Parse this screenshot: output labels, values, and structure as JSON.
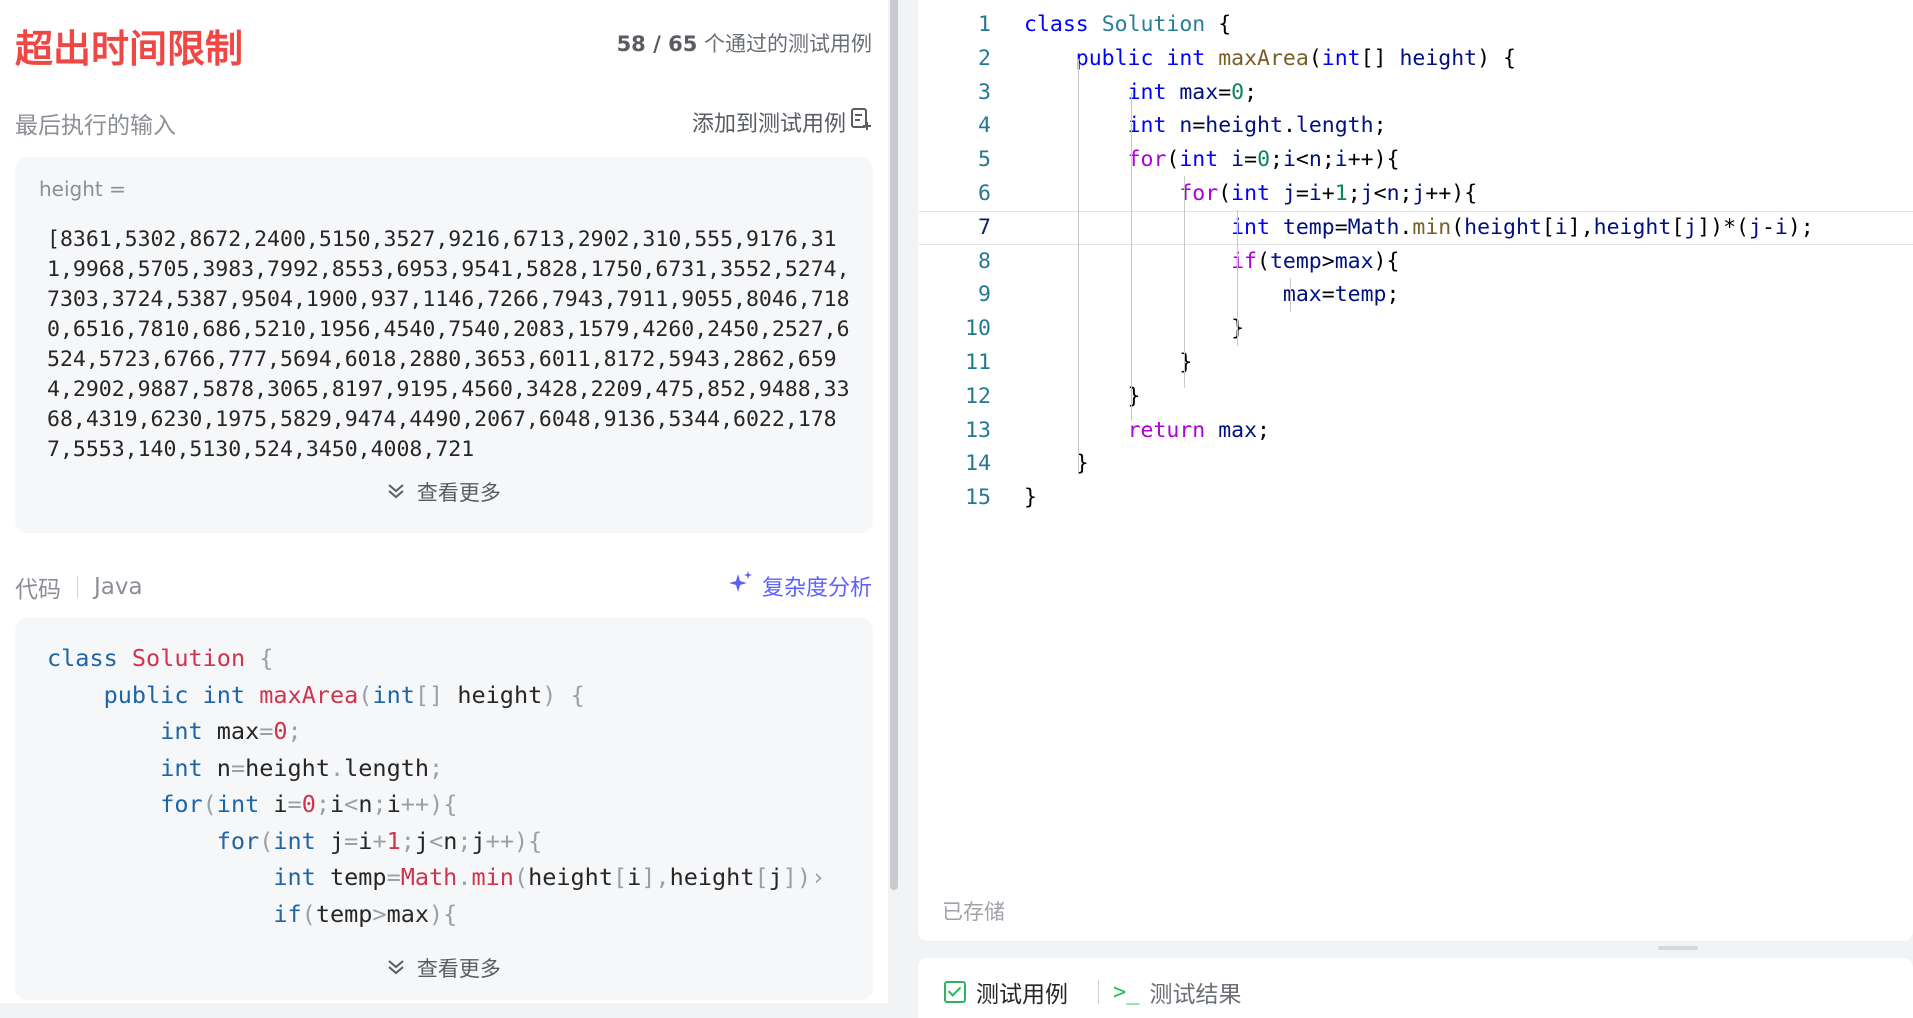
{
  "result": {
    "status_title": "超出时间限制",
    "passed": "58 / 65",
    "passed_suffix": "个通过的测试用例"
  },
  "last_input": {
    "label": "最后执行的输入",
    "add_case_label": "添加到测试用例",
    "variable_label": "height =",
    "value": "[8361,5302,8672,2400,5150,3527,9216,6713,2902,310,555,9176,311,9968,5705,3983,7992,8553,6953,9541,5828,1750,6731,3552,5274,7303,3724,5387,9504,1900,937,1146,7266,7943,7911,9055,8046,7180,6516,7810,686,5210,1956,4540,7540,2083,1579,4260,2450,2527,6524,5723,6766,777,5694,6018,2880,3653,6011,8172,5943,2862,6594,2902,9887,5878,3065,8197,9195,4560,3428,2209,475,852,9488,3368,4319,6230,1975,5829,9474,4490,2067,6048,9136,5344,6022,1787,5553,140,5130,524,3450,4008,721",
    "view_more": "查看更多"
  },
  "code_section": {
    "label": "代码",
    "language": "Java",
    "complexity_label": "复杂度分析",
    "view_more": "查看更多"
  },
  "editor": {
    "lines": [
      "class Solution {",
      "    public int maxArea(int[] height) {",
      "        int max=0;",
      "        int n=height.length;",
      "        for(int i=0;i<n;i++){",
      "            for(int j=i+1;j<n;j++){",
      "                int temp=Math.min(height[i],height[j])*(j-i);",
      "                if(temp>max){",
      "                    max=temp;",
      "                }",
      "            }",
      "        }",
      "        return max;",
      "    }",
      "}"
    ],
    "active_line": 7,
    "saved_label": "已存储"
  },
  "bottom_tabs": {
    "test_cases": "测试用例",
    "test_results": "测试结果"
  }
}
